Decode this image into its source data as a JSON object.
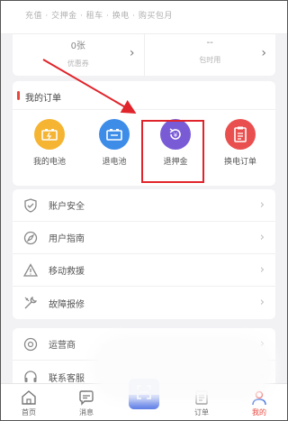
{
  "top_strip": {
    "text": "充值 · 交押金 · 租车 · 换电 · 购买包月"
  },
  "stats": [
    {
      "value": "0张",
      "label": "优惠券"
    },
    {
      "value": "--",
      "label": "包时用"
    }
  ],
  "orders": {
    "title": "我的订单",
    "items": [
      {
        "label": "我的电池",
        "color": "#f5b432",
        "icon": "battery-charge-icon"
      },
      {
        "label": "退电池",
        "color": "#3d8ce8",
        "icon": "battery-return-icon"
      },
      {
        "label": "退押金",
        "color": "#7a5bd6",
        "icon": "deposit-refund-icon"
      },
      {
        "label": "换电订单",
        "color": "#ea4f4f",
        "icon": "order-clipboard-icon"
      }
    ]
  },
  "menu": {
    "group1": [
      {
        "label": "账户安全",
        "icon": "shield-icon"
      },
      {
        "label": "用户指南",
        "icon": "compass-icon"
      },
      {
        "label": "移动救援",
        "icon": "warning-triangle-icon"
      },
      {
        "label": "故障报修",
        "icon": "wrench-icon"
      }
    ],
    "group2": [
      {
        "label": "运营商",
        "icon": "operator-icon"
      },
      {
        "label": "联系客服",
        "icon": "headset-icon"
      }
    ]
  },
  "tabbar": [
    {
      "label": "首页",
      "icon": "home-icon"
    },
    {
      "label": "消息",
      "icon": "message-icon"
    },
    {
      "label": "",
      "icon": "scan-icon"
    },
    {
      "label": "订单",
      "icon": "order-icon"
    },
    {
      "label": "我的",
      "icon": "user-icon"
    }
  ],
  "colors": {
    "accent": "#5577e6",
    "highlight": "#e0242b",
    "active_tab": "#e8473c"
  }
}
